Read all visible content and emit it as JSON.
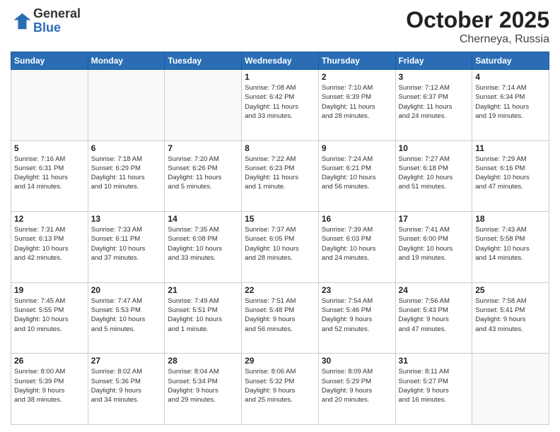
{
  "logo": {
    "general": "General",
    "blue": "Blue"
  },
  "title": "October 2025",
  "subtitle": "Cherneya, Russia",
  "days_header": [
    "Sunday",
    "Monday",
    "Tuesday",
    "Wednesday",
    "Thursday",
    "Friday",
    "Saturday"
  ],
  "weeks": [
    [
      {
        "day": "",
        "info": ""
      },
      {
        "day": "",
        "info": ""
      },
      {
        "day": "",
        "info": ""
      },
      {
        "day": "1",
        "info": "Sunrise: 7:08 AM\nSunset: 6:42 PM\nDaylight: 11 hours\nand 33 minutes."
      },
      {
        "day": "2",
        "info": "Sunrise: 7:10 AM\nSunset: 6:39 PM\nDaylight: 11 hours\nand 28 minutes."
      },
      {
        "day": "3",
        "info": "Sunrise: 7:12 AM\nSunset: 6:37 PM\nDaylight: 11 hours\nand 24 minutes."
      },
      {
        "day": "4",
        "info": "Sunrise: 7:14 AM\nSunset: 6:34 PM\nDaylight: 11 hours\nand 19 minutes."
      }
    ],
    [
      {
        "day": "5",
        "info": "Sunrise: 7:16 AM\nSunset: 6:31 PM\nDaylight: 11 hours\nand 14 minutes."
      },
      {
        "day": "6",
        "info": "Sunrise: 7:18 AM\nSunset: 6:29 PM\nDaylight: 11 hours\nand 10 minutes."
      },
      {
        "day": "7",
        "info": "Sunrise: 7:20 AM\nSunset: 6:26 PM\nDaylight: 11 hours\nand 5 minutes."
      },
      {
        "day": "8",
        "info": "Sunrise: 7:22 AM\nSunset: 6:23 PM\nDaylight: 11 hours\nand 1 minute."
      },
      {
        "day": "9",
        "info": "Sunrise: 7:24 AM\nSunset: 6:21 PM\nDaylight: 10 hours\nand 56 minutes."
      },
      {
        "day": "10",
        "info": "Sunrise: 7:27 AM\nSunset: 6:18 PM\nDaylight: 10 hours\nand 51 minutes."
      },
      {
        "day": "11",
        "info": "Sunrise: 7:29 AM\nSunset: 6:16 PM\nDaylight: 10 hours\nand 47 minutes."
      }
    ],
    [
      {
        "day": "12",
        "info": "Sunrise: 7:31 AM\nSunset: 6:13 PM\nDaylight: 10 hours\nand 42 minutes."
      },
      {
        "day": "13",
        "info": "Sunrise: 7:33 AM\nSunset: 6:11 PM\nDaylight: 10 hours\nand 37 minutes."
      },
      {
        "day": "14",
        "info": "Sunrise: 7:35 AM\nSunset: 6:08 PM\nDaylight: 10 hours\nand 33 minutes."
      },
      {
        "day": "15",
        "info": "Sunrise: 7:37 AM\nSunset: 6:05 PM\nDaylight: 10 hours\nand 28 minutes."
      },
      {
        "day": "16",
        "info": "Sunrise: 7:39 AM\nSunset: 6:03 PM\nDaylight: 10 hours\nand 24 minutes."
      },
      {
        "day": "17",
        "info": "Sunrise: 7:41 AM\nSunset: 6:00 PM\nDaylight: 10 hours\nand 19 minutes."
      },
      {
        "day": "18",
        "info": "Sunrise: 7:43 AM\nSunset: 5:58 PM\nDaylight: 10 hours\nand 14 minutes."
      }
    ],
    [
      {
        "day": "19",
        "info": "Sunrise: 7:45 AM\nSunset: 5:55 PM\nDaylight: 10 hours\nand 10 minutes."
      },
      {
        "day": "20",
        "info": "Sunrise: 7:47 AM\nSunset: 5:53 PM\nDaylight: 10 hours\nand 5 minutes."
      },
      {
        "day": "21",
        "info": "Sunrise: 7:49 AM\nSunset: 5:51 PM\nDaylight: 10 hours\nand 1 minute."
      },
      {
        "day": "22",
        "info": "Sunrise: 7:51 AM\nSunset: 5:48 PM\nDaylight: 9 hours\nand 56 minutes."
      },
      {
        "day": "23",
        "info": "Sunrise: 7:54 AM\nSunset: 5:46 PM\nDaylight: 9 hours\nand 52 minutes."
      },
      {
        "day": "24",
        "info": "Sunrise: 7:56 AM\nSunset: 5:43 PM\nDaylight: 9 hours\nand 47 minutes."
      },
      {
        "day": "25",
        "info": "Sunrise: 7:58 AM\nSunset: 5:41 PM\nDaylight: 9 hours\nand 43 minutes."
      }
    ],
    [
      {
        "day": "26",
        "info": "Sunrise: 8:00 AM\nSunset: 5:39 PM\nDaylight: 9 hours\nand 38 minutes."
      },
      {
        "day": "27",
        "info": "Sunrise: 8:02 AM\nSunset: 5:36 PM\nDaylight: 9 hours\nand 34 minutes."
      },
      {
        "day": "28",
        "info": "Sunrise: 8:04 AM\nSunset: 5:34 PM\nDaylight: 9 hours\nand 29 minutes."
      },
      {
        "day": "29",
        "info": "Sunrise: 8:06 AM\nSunset: 5:32 PM\nDaylight: 9 hours\nand 25 minutes."
      },
      {
        "day": "30",
        "info": "Sunrise: 8:09 AM\nSunset: 5:29 PM\nDaylight: 9 hours\nand 20 minutes."
      },
      {
        "day": "31",
        "info": "Sunrise: 8:11 AM\nSunset: 5:27 PM\nDaylight: 9 hours\nand 16 minutes."
      },
      {
        "day": "",
        "info": ""
      }
    ]
  ]
}
